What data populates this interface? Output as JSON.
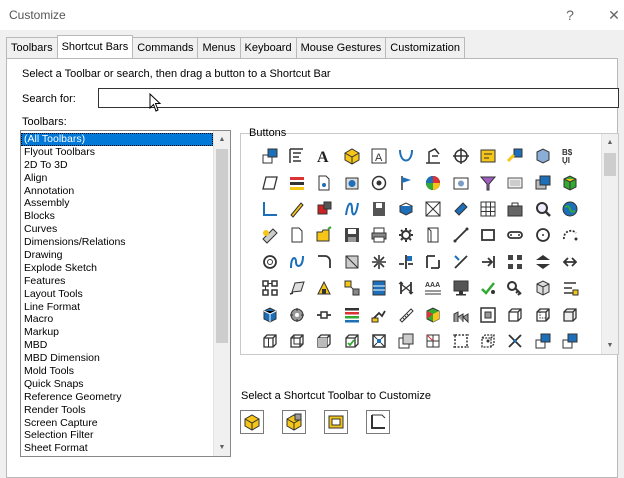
{
  "window": {
    "title": "Customize",
    "help_label": "?",
    "close_label": "✕"
  },
  "tabs": [
    {
      "label": "Toolbars",
      "active": false
    },
    {
      "label": "Shortcut Bars",
      "active": true
    },
    {
      "label": "Commands",
      "active": false
    },
    {
      "label": "Menus",
      "active": false
    },
    {
      "label": "Keyboard",
      "active": false
    },
    {
      "label": "Mouse Gestures",
      "active": false
    },
    {
      "label": "Customization",
      "active": false
    }
  ],
  "instruction": "Select a Toolbar or search, then drag a button to a Shortcut Bar",
  "search": {
    "label": "Search for:",
    "value": ""
  },
  "toolbars": {
    "label": "Toolbars:",
    "selected_index": 0,
    "items": [
      "(All Toolbars)",
      "Flyout Toolbars",
      "2D To 3D",
      "Align",
      "Annotation",
      "Assembly",
      "Blocks",
      "Curves",
      "Dimensions/Relations",
      "Drawing",
      "Explode Sketch",
      "Features",
      "Layout Tools",
      "Line Format",
      "Macro",
      "Markup",
      "MBD",
      "MBD Dimension",
      "Mold Tools",
      "Quick Snaps",
      "Reference Geometry",
      "Render Tools",
      "Screen Capture",
      "Selection Filter",
      "Sheet Format"
    ]
  },
  "buttons": {
    "label": "Buttons",
    "icons": [
      "dimension-icon",
      "note-icon",
      "font-icon",
      "part-icon",
      "image-note-icon",
      "spline-icon",
      "datum-icon",
      "crosshair-icon",
      "sheet-icon",
      "bom-icon",
      "cube-icon",
      "text-format-icon",
      "plane-icon",
      "color-bars-icon",
      "document-icon",
      "camera-icon",
      "target-icon",
      "flag-icon",
      "color-wheel-icon",
      "photo-icon",
      "filter-icon",
      "frame-icon",
      "assembly-icon",
      "blocks-icon",
      "corner-icon",
      "pencil-icon",
      "red-part-icon",
      "curve-icon",
      "save-icon",
      "stack-icon",
      "box-icon",
      "bookmark-icon",
      "table-icon",
      "briefcase-icon",
      "magnify-icon",
      "globe-icon",
      "edit-part-icon",
      "blank-doc-icon",
      "open-folder-icon",
      "floppy-icon",
      "printer-icon",
      "gear-icon",
      "page-icon",
      "line-icon",
      "rectangle-icon",
      "slot-icon",
      "circle-icon",
      "arc-icon",
      "ring-icon",
      "s-curve-icon",
      "fillet-icon",
      "block-icon",
      "network-icon",
      "split-icon",
      "convert-icon",
      "trim-icon",
      "extend-icon",
      "pattern-icon",
      "mirror-icon",
      "move-icon",
      "grid-icon",
      "loft-icon",
      "cut-icon",
      "explode-icon",
      "components-icon",
      "rotate-icon",
      "swap-icon",
      "text-pattern-icon",
      "monitor-icon",
      "checkmark-icon",
      "key-icon",
      "view-icon",
      "align-icon",
      "blue-cube-icon",
      "wheel-icon",
      "distribute-icon",
      "stripes-icon",
      "mate-icon",
      "ruler-icon",
      "shaded-icon",
      "factory-icon",
      "frame-box-icon",
      "outline-cube-icon",
      "wire-cube-icon",
      "box-corner-icon",
      "box-split-icon",
      "box-open-icon",
      "box-edge-icon",
      "box-face-icon",
      "check-face-icon",
      "scan-icon",
      "doc-stack-icon",
      "section-icon",
      "dashed-box-icon",
      "dashed-cube-icon",
      "compass-icon"
    ]
  },
  "shortcut": {
    "label": "Select a Shortcut Toolbar to Customize",
    "items": [
      "part-toolbar-icon",
      "assembly-toolbar-icon",
      "drawing-toolbar-icon",
      "sketch-toolbar-icon"
    ]
  },
  "colors": {
    "accent": "#0078d7",
    "selection_text": "#ffffff",
    "icon_blue": "#1c6fb8",
    "icon_yellow": "#f5c518"
  }
}
